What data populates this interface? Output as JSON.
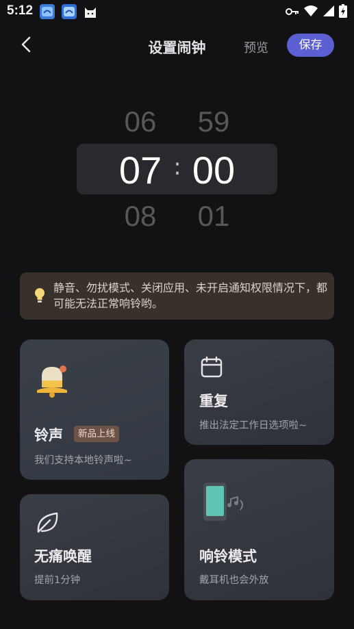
{
  "status_bar": {
    "time": "5:12",
    "app_icons": [
      "app-icon-1",
      "app-icon-2",
      "cat-icon"
    ],
    "indicators": [
      "key-icon",
      "wifi-icon",
      "signal-icon",
      "battery-charging-icon"
    ]
  },
  "header": {
    "title": "设置闹钟",
    "preview_label": "预览",
    "save_label": "保存",
    "accent_color": "#5b5fd1"
  },
  "time_picker": {
    "hour_prev": "06",
    "hour": "07",
    "hour_next": "08",
    "minute_prev": "59",
    "minute": "00",
    "minute_next": "01",
    "separator": ":"
  },
  "tip": {
    "icon": "lightbulb-icon",
    "text": "静音、勿扰模式、关闭应用、未开启通知权限情况下，都可能无法正常响铃哟。"
  },
  "cards": {
    "ringtone": {
      "title": "铃声",
      "badge": "新品上线",
      "subtitle": "我们支持本地铃声啦~",
      "icon": "bell-icon"
    },
    "repeat": {
      "title": "重复",
      "subtitle": "推出法定工作日选项啦~",
      "icon": "calendar-icon"
    },
    "gentle_wake": {
      "title": "无痛唤醒",
      "subtitle": "提前1分钟",
      "icon": "leaf-icon"
    },
    "ring_mode": {
      "title": "响铃模式",
      "subtitle": "戴耳机也会外放",
      "icon": "phone-music-icon"
    }
  }
}
